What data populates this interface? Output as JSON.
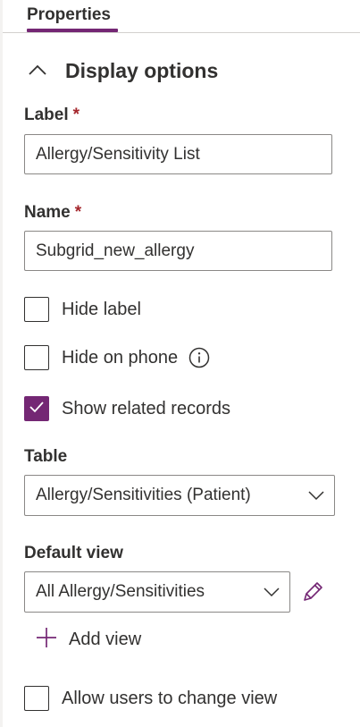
{
  "tabs": {
    "properties": "Properties"
  },
  "section": {
    "title": "Display options"
  },
  "label_field": {
    "label": "Label",
    "required_mark": "*",
    "value": "Allergy/Sensitivity List"
  },
  "name_field": {
    "label": "Name",
    "required_mark": "*",
    "value": "Subgrid_new_allergy"
  },
  "checkboxes": {
    "hide_label": {
      "label": "Hide label",
      "checked": false
    },
    "hide_on_phone": {
      "label": "Hide on phone",
      "checked": false
    },
    "show_related": {
      "label": "Show related records",
      "checked": true
    },
    "allow_change_view": {
      "label": "Allow users to change view",
      "checked": false
    }
  },
  "table_field": {
    "label": "Table",
    "value": "Allergy/Sensitivities (Patient)"
  },
  "default_view_field": {
    "label": "Default view",
    "value": "All Allergy/Sensitivities"
  },
  "add_view": {
    "label": "Add view"
  },
  "colors": {
    "accent": "#742774",
    "required": "#a4262c",
    "text": "#323130",
    "border": "#8a8886"
  },
  "icons": {
    "collapse": "chevron-up-icon",
    "info": "info-icon",
    "dropdown": "chevron-down-icon",
    "edit": "pencil-icon",
    "add": "plus-icon",
    "check": "checkmark-icon"
  }
}
